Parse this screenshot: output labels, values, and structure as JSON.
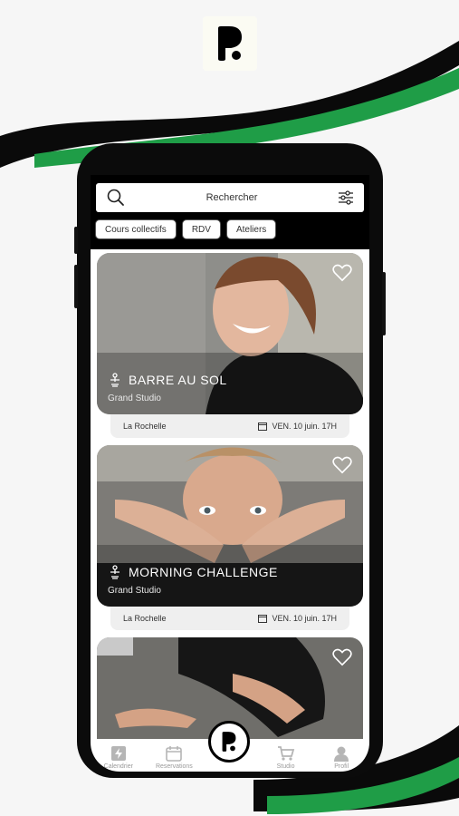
{
  "search": {
    "placeholder": "Rechercher"
  },
  "filters": [
    {
      "label": "Cours collectifs"
    },
    {
      "label": "RDV"
    },
    {
      "label": "Ateliers"
    }
  ],
  "cards": [
    {
      "title": "BARRE AU SOL",
      "studio": "Grand Studio",
      "location": "La Rochelle",
      "date": "VEN. 10 juin. 17H"
    },
    {
      "title": "MORNING CHALLENGE",
      "studio": "Grand Studio",
      "location": "La Rochelle",
      "date": "VEN. 10 juin. 17H"
    },
    {
      "title": "",
      "studio": "",
      "location": "",
      "date": ""
    }
  ],
  "tabs": [
    {
      "label": "Calendrier",
      "icon": "lightning-icon"
    },
    {
      "label": "Reservations",
      "icon": "calendar-icon"
    },
    {
      "label": "Studio",
      "icon": "cart-icon"
    },
    {
      "label": "Profil",
      "icon": "user-icon"
    }
  ],
  "colors": {
    "accent_green": "#1f9d47",
    "swoosh_black": "#0a0a0a",
    "background": "#f6f6f6"
  }
}
